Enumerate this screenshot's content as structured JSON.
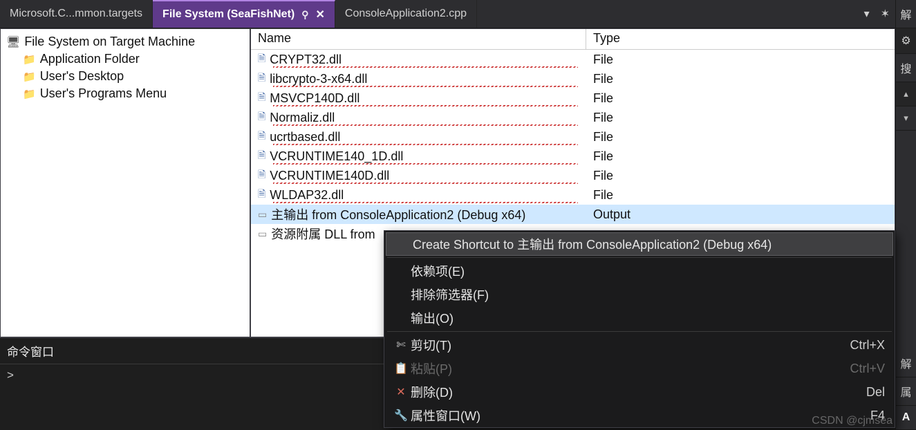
{
  "tabs": [
    {
      "label": "Microsoft.C...mmon.targets"
    },
    {
      "label": "File System (SeaFishNet)",
      "pin_glyph": "⚲",
      "close_glyph": "✕"
    },
    {
      "label": "ConsoleApplication2.cpp"
    }
  ],
  "tab_ctrls": {
    "dropdown": "▾",
    "gear": "✶"
  },
  "tree": {
    "root": "File System on Target Machine",
    "items": [
      "Application Folder",
      "User's Desktop",
      "User's Programs Menu"
    ]
  },
  "list": {
    "headers": {
      "name": "Name",
      "type": "Type"
    },
    "rows": [
      {
        "icon": "file",
        "name": "CRYPT32.dll",
        "type": "File",
        "squiggly": true
      },
      {
        "icon": "file",
        "name": "libcrypto-3-x64.dll",
        "type": "File",
        "squiggly": true
      },
      {
        "icon": "file",
        "name": "MSVCP140D.dll",
        "type": "File",
        "squiggly": true
      },
      {
        "icon": "file",
        "name": "Normaliz.dll",
        "type": "File",
        "squiggly": true
      },
      {
        "icon": "file",
        "name": "ucrtbased.dll",
        "type": "File",
        "squiggly": true
      },
      {
        "icon": "file",
        "name": "VCRUNTIME140_1D.dll",
        "type": "File",
        "squiggly": true
      },
      {
        "icon": "file",
        "name": "VCRUNTIME140D.dll",
        "type": "File",
        "squiggly": true
      },
      {
        "icon": "file",
        "name": "WLDAP32.dll",
        "type": "File",
        "squiggly": true
      },
      {
        "icon": "out",
        "name": "主输出 from ConsoleApplication2 (Debug x64)",
        "type": "Output",
        "selected": true
      },
      {
        "icon": "out",
        "name": "资源附属 DLL from",
        "type": ""
      }
    ]
  },
  "context_menu": {
    "items": [
      {
        "label": "Create Shortcut to 主输出 from ConsoleApplication2 (Debug x64)"
      },
      {
        "label": "依赖项(E)"
      },
      {
        "label": "排除筛选器(F)"
      },
      {
        "label": "输出(O)"
      },
      {
        "icon": "✄",
        "label": "剪切(T)",
        "accel": "Ctrl+X"
      },
      {
        "icon": "📋",
        "label": "粘贴(P)",
        "accel": "Ctrl+V"
      },
      {
        "icon": "✕",
        "label": "删除(D)",
        "accel": "Del"
      },
      {
        "icon": "🔧",
        "label": "属性窗口(W)",
        "accel": "F4"
      }
    ]
  },
  "command_window": {
    "title": "命令窗口",
    "prompt": ">"
  },
  "right_sidebar": [
    "解",
    "⚙",
    "搜",
    "▴",
    "▾",
    "解",
    "属",
    "A"
  ],
  "watermark": "CSDN @cjmsea"
}
